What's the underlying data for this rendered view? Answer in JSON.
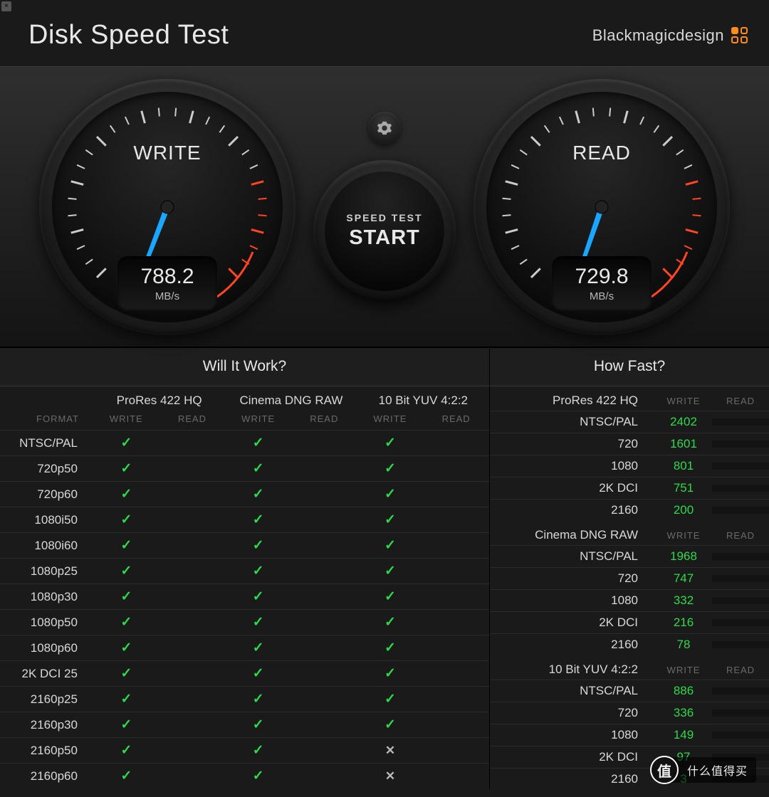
{
  "header": {
    "title": "Disk Speed Test",
    "brand": "Blackmagicdesign"
  },
  "gauges": {
    "write": {
      "title": "WRITE",
      "value": "788.2",
      "unit": "MB/s"
    },
    "read": {
      "title": "READ",
      "value": "729.8",
      "unit": "MB/s"
    }
  },
  "center": {
    "speed_test": "SPEED TEST",
    "start": "START"
  },
  "will_it_work": {
    "title": "Will It Work?",
    "format_label": "FORMAT",
    "groups": [
      "ProRes 422 HQ",
      "Cinema DNG RAW",
      "10 Bit YUV 4:2:2"
    ],
    "columns": [
      "WRITE",
      "READ"
    ],
    "rows": [
      {
        "label": "NTSC/PAL",
        "cells": [
          "check",
          "",
          "check",
          "",
          "check",
          ""
        ]
      },
      {
        "label": "720p50",
        "cells": [
          "check",
          "",
          "check",
          "",
          "check",
          ""
        ]
      },
      {
        "label": "720p60",
        "cells": [
          "check",
          "",
          "check",
          "",
          "check",
          ""
        ]
      },
      {
        "label": "1080i50",
        "cells": [
          "check",
          "",
          "check",
          "",
          "check",
          ""
        ]
      },
      {
        "label": "1080i60",
        "cells": [
          "check",
          "",
          "check",
          "",
          "check",
          ""
        ]
      },
      {
        "label": "1080p25",
        "cells": [
          "check",
          "",
          "check",
          "",
          "check",
          ""
        ]
      },
      {
        "label": "1080p30",
        "cells": [
          "check",
          "",
          "check",
          "",
          "check",
          ""
        ]
      },
      {
        "label": "1080p50",
        "cells": [
          "check",
          "",
          "check",
          "",
          "check",
          ""
        ]
      },
      {
        "label": "1080p60",
        "cells": [
          "check",
          "",
          "check",
          "",
          "check",
          ""
        ]
      },
      {
        "label": "2K DCI 25",
        "cells": [
          "check",
          "",
          "check",
          "",
          "check",
          ""
        ]
      },
      {
        "label": "2160p25",
        "cells": [
          "check",
          "",
          "check",
          "",
          "check",
          ""
        ]
      },
      {
        "label": "2160p30",
        "cells": [
          "check",
          "",
          "check",
          "",
          "check",
          ""
        ]
      },
      {
        "label": "2160p50",
        "cells": [
          "check",
          "",
          "check",
          "",
          "cross",
          ""
        ]
      },
      {
        "label": "2160p60",
        "cells": [
          "check",
          "",
          "check",
          "",
          "cross",
          ""
        ]
      }
    ]
  },
  "how_fast": {
    "title": "How Fast?",
    "columns": [
      "WRITE",
      "READ"
    ],
    "groups": [
      {
        "name": "ProRes 422 HQ",
        "rows": [
          {
            "label": "NTSC/PAL",
            "write": "2402",
            "read": ""
          },
          {
            "label": "720",
            "write": "1601",
            "read": ""
          },
          {
            "label": "1080",
            "write": "801",
            "read": ""
          },
          {
            "label": "2K DCI",
            "write": "751",
            "read": ""
          },
          {
            "label": "2160",
            "write": "200",
            "read": ""
          }
        ]
      },
      {
        "name": "Cinema DNG RAW",
        "rows": [
          {
            "label": "NTSC/PAL",
            "write": "1968",
            "read": ""
          },
          {
            "label": "720",
            "write": "747",
            "read": ""
          },
          {
            "label": "1080",
            "write": "332",
            "read": ""
          },
          {
            "label": "2K DCI",
            "write": "216",
            "read": ""
          },
          {
            "label": "2160",
            "write": "78",
            "read": ""
          }
        ]
      },
      {
        "name": "10 Bit YUV 4:2:2",
        "rows": [
          {
            "label": "NTSC/PAL",
            "write": "886",
            "read": ""
          },
          {
            "label": "720",
            "write": "336",
            "read": ""
          },
          {
            "label": "1080",
            "write": "149",
            "read": ""
          },
          {
            "label": "2K DCI",
            "write": "97",
            "read": ""
          },
          {
            "label": "2160",
            "write": "3",
            "read": ""
          }
        ]
      }
    ]
  },
  "watermark": {
    "badge": "值",
    "text": "什么值得买"
  }
}
